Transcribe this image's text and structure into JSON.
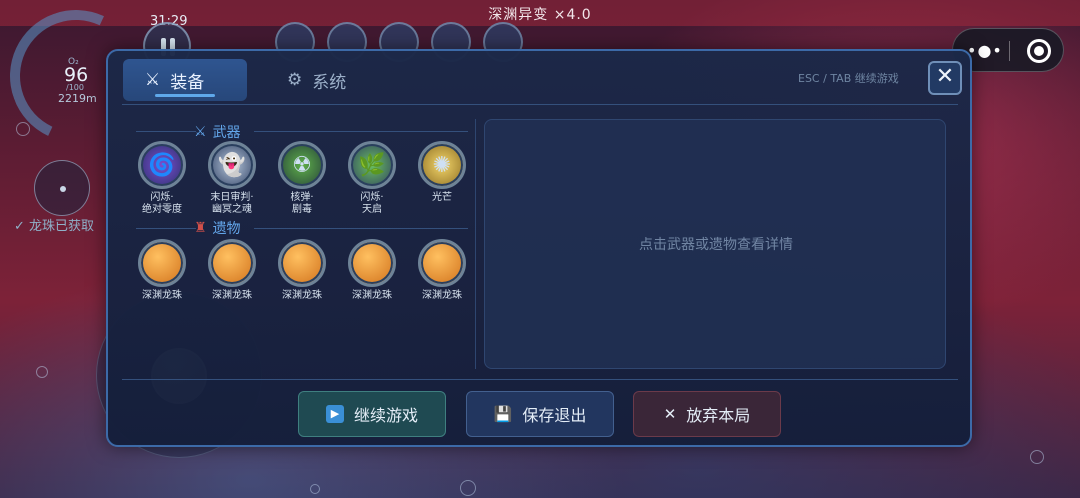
{
  "hud": {
    "title": "深渊异变 ×4.0",
    "timer": "31:29",
    "depth_o2": "O₂",
    "depth_value": "96",
    "depth_sub": "/100",
    "depth_meters": "2219m",
    "collected_text": "✓ 龙珠已获取"
  },
  "modal": {
    "tabs": [
      {
        "label": "装备",
        "icon": "crossed-swords-icon"
      },
      {
        "label": "系统",
        "icon": "gear-icon"
      }
    ],
    "hint": "ESC / TAB 继续游戏",
    "close_label": "✕",
    "weapons_title": "武器",
    "relics_title": "遗物",
    "weapons": [
      {
        "label": "闪烁·\n绝对零度",
        "color": "#7a4fd0"
      },
      {
        "label": "末日审判·\n幽冥之魂",
        "color": "#b8c8dc"
      },
      {
        "label": "核弹·\n剧毒",
        "color": "#5fb04a"
      },
      {
        "label": "闪烁·\n天启",
        "color": "#6cc060"
      },
      {
        "label": "光芒",
        "color": "#e0b84a"
      }
    ],
    "relics": [
      {
        "label": "深渊龙珠",
        "color": "#e88a28"
      },
      {
        "label": "深渊龙珠",
        "color": "#e88a28"
      },
      {
        "label": "深渊龙珠",
        "color": "#e88a28"
      },
      {
        "label": "深渊龙珠",
        "color": "#e88a28"
      },
      {
        "label": "深渊龙珠",
        "color": "#e88a28"
      }
    ],
    "detail_placeholder": "点击武器或遗物查看详情",
    "buttons": {
      "continue": "继续游戏",
      "save": "保存退出",
      "quit": "放弃本局"
    }
  }
}
